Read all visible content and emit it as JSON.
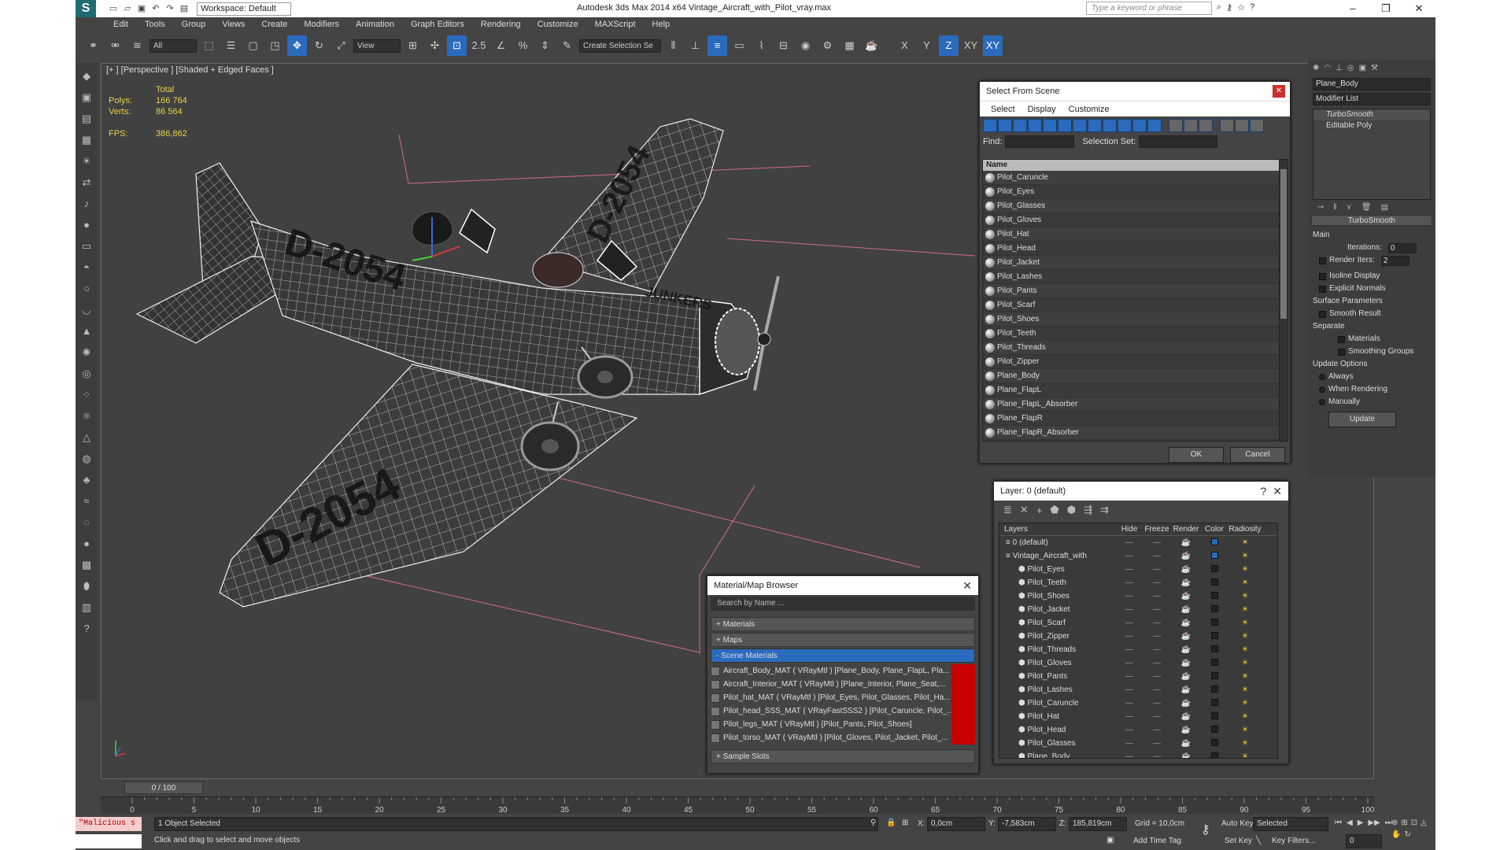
{
  "app": {
    "title": "Autodesk 3ds Max  2014 x64    Vintage_Aircraft_with_Pilot_vray.max",
    "workspace": "Workspace: Default",
    "search_placeholder": "Type a keyword or phrase"
  },
  "menu": [
    "Edit",
    "Tools",
    "Group",
    "Views",
    "Create",
    "Modifiers",
    "Animation",
    "Graph Editors",
    "Rendering",
    "Customize",
    "MAXScript",
    "Help"
  ],
  "toolbar": {
    "filter": "All",
    "refcoord": "View",
    "selset": "Create Selection Se",
    "snap": "2.5",
    "axes": [
      "X",
      "Y",
      "Z",
      "XY",
      "XY"
    ]
  },
  "viewport": {
    "label": "[+ ] [Perspective ] [Shaded + Edged Faces ]",
    "stats_total": "Total",
    "polys_label": "Polys:",
    "polys": "166 764",
    "verts_label": "Verts:",
    "verts": "86 564",
    "fps_label": "FPS:",
    "fps": "386,862",
    "reg_top": "D-2054",
    "reg_wing": "D-2054",
    "reg_wing2": "D-2054",
    "nose": "JUNKERS"
  },
  "select_from_scene": {
    "title": "Select From Scene",
    "menus": [
      "Select",
      "Display",
      "Customize"
    ],
    "find_label": "Find:",
    "selset_label": "Selection Set:",
    "col_name": "Name",
    "items": [
      "Pilot_Caruncle",
      "Pilot_Eyes",
      "Pilot_Glasses",
      "Pilot_Gloves",
      "Pilot_Hat",
      "Pilot_Head",
      "Pilot_Jacket",
      "Pilot_Lashes",
      "Pilot_Pants",
      "Pilot_Scarf",
      "Pilot_Shoes",
      "Pilot_Teeth",
      "Pilot_Threads",
      "Pilot_Zipper",
      "Plane_Body",
      "Plane_FlapL",
      "Plane_FlapL_Absorber",
      "Plane_FlapR",
      "Plane_FlapR_Absorber"
    ],
    "ok": "OK",
    "cancel": "Cancel"
  },
  "layer": {
    "title": "Layer: 0 (default)",
    "help": "?",
    "cols": [
      "Layers",
      "Hide",
      "Freeze",
      "Render",
      "Color",
      "Radiosity"
    ],
    "rows": [
      "0 (default)",
      "Vintage_Aircraft_with",
      "Pilot_Eyes",
      "Pilot_Teeth",
      "Pilot_Shoes",
      "Pilot_Jacket",
      "Pilot_Scarf",
      "Pilot_Zipper",
      "Pilot_Threads",
      "Pilot_Gloves",
      "Pilot_Pants",
      "Pilot_Lashes",
      "Pilot_Caruncle",
      "Pilot_Hat",
      "Pilot_Head",
      "Pilot_Glasses",
      "Plane_Body"
    ]
  },
  "material_browser": {
    "title": "Material/Map Browser",
    "search": "Search by Name ...",
    "materials": "+ Materials",
    "maps": "+ Maps",
    "scene_materials": "- Scene Materials",
    "sample_slots": "+ Sample Slots",
    "items": [
      "Aircraft_Body_MAT ( VRayMtl ) [Plane_Body, Plane_FlapL, Pla...",
      "Aircraft_Interior_MAT ( VRayMtl ) [Plane_Interior, Plane_Seat,...",
      "Pilot_hat_MAT ( VRayMtl ) [Pilot_Eyes, Pilot_Glasses, Pilot_Ha...",
      "Pilot_head_SSS_MAT ( VRayFastSSS2 ) [Pilot_Caruncle, Pilot_...",
      "Pilot_legs_MAT ( VRayMtl ) [Pilot_Pants, Pilot_Shoes]",
      "Pilot_torso_MAT ( VRayMtl ) [Pilot_Gloves, Pilot_Jacket, Pilot_..."
    ]
  },
  "modify_panel": {
    "object_name": "Plane_Body",
    "modifier_list": "Modifier List",
    "stack": [
      "TurboSmooth",
      "Editable Poly"
    ],
    "rollout": "TurboSmooth",
    "main": "Main",
    "iterations_label": "Iterations:",
    "iterations": "0",
    "render_iters_label": "Render Iters:",
    "render_iters": "2",
    "isoline": "Isoline Display",
    "explicit": "Explicit Normals",
    "surface_params": "Surface Parameters",
    "smooth_result": "Smooth Result",
    "separate": "Separate",
    "materials": "Materials",
    "smoothing_groups": "Smoothing Groups",
    "update_options": "Update Options",
    "always": "Always",
    "when_rendering": "When Rendering",
    "manually": "Manually",
    "update": "Update"
  },
  "timeline": {
    "frame": "0 / 100",
    "ticks": [
      "0",
      "5",
      "10",
      "15",
      "20",
      "25",
      "30",
      "35",
      "40",
      "45",
      "50",
      "55",
      "60",
      "65",
      "70",
      "75",
      "80",
      "85",
      "90",
      "95",
      "100"
    ]
  },
  "status": {
    "script1": "\"Malicious s",
    "selected": "1 Object Selected",
    "hint": "Click and drag to select and move objects",
    "x_label": "X:",
    "x": "0,0cm",
    "y_label": "Y:",
    "y": "-7,583cm",
    "z_label": "Z:",
    "z": "185,819cm",
    "grid": "Grid = 10,0cm",
    "add_time_tag": "Add Time Tag",
    "auto_key": "Auto Key",
    "set_key": "Set Key",
    "selected_dd": "Selected",
    "key_filters": "Key Filters...",
    "frame_field": "0"
  }
}
